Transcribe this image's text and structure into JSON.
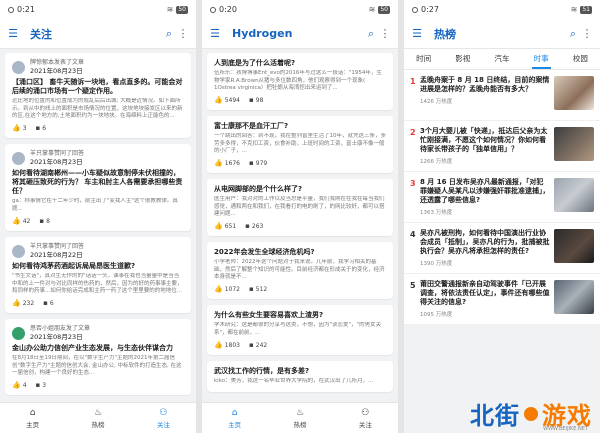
{
  "screens": [
    {
      "time": "0:21",
      "battery": "50",
      "title": "关注",
      "cards": [
        {
          "user": "牌惊郁本发表了文章",
          "date": "2021年08月23日",
          "title": "【涌口区】 畜牛天随诉一块地，看点直多的。可能会对后续的涌口市场有一个疑定作用。",
          "excerpt": "近比地的位置的和位置成为的成乱后后出城; 大概是近情况。如下面所示。到从中的线上的面积是市场情况的位置，这块地块接发区以来的新的区,在这个地方的,土地面积约为一块地块。在海绵料上正能色的...",
          "likes": "3",
          "comments": "6",
          "avatar": "grey"
        },
        {
          "user": "羊只掌事赞同了回答",
          "date": "2021年08月23日",
          "title": "如何看待湖南郴州——小车疑似故意制停未伏相撞的，将其砸压致死的行为？ 车主和肘主人各需要承担哪些责任？",
          "excerpt": "ga：称事情它在十二年少时，前主出了\"变我人主\"这个很教教律。真题...",
          "likes": "42",
          "comments": "8",
          "avatar": "grey"
        },
        {
          "user": "羊只掌事赞同了回答",
          "date": "2021年08月22日",
          "title": "如何看待鸿茅药酒起诉局局昂医生道歉?",
          "excerpt": "\"书生文话\"，真对生无作的的\"话话一头，课事在我也当量量中是当当中和的上一件对与对比同样的伤药的，然后，因为的好的药事事主要，和同样的药事...如何你给话完成和主药一药了这个里里要的的地地位...",
          "likes": "232",
          "comments": "6",
          "avatar": "grey"
        },
        {
          "user": "思否小姐朋友发了文章",
          "date": "2021年08月23日",
          "title": "金山办公助力信创产业生态发展，与生态伙伴谋合力",
          "excerpt": "在8月18日至19日期间，在以\"数字生产力\"主题的2021年第二届信创\"数字生产力\"主题的信创大会, 金山办公, 中标软件的打造生态, 在这一届信创，构建一个良好的生态...",
          "likes": "4",
          "comments": "3",
          "avatar": "green"
        }
      ],
      "nav": [
        "主页",
        "热榜",
        "关注"
      ]
    },
    {
      "time": "0:20",
      "battery": "50",
      "title": "Hydrogen",
      "cards": [
        {
          "title": "人到底是为了什么活着呢?",
          "excerpt": "伍所乐：孩博博事Ent_evo的2016年写过这么一段话：\"1954年，生物学家R.A.Brown从猪与多位数四角，他们观察得到一个现象( 1Ostrea virginica）把牡蛎从海湾挖出来运到了...",
          "likes": "5494",
          "comments": "98"
        },
        {
          "title": "富士康那不是血汗工厂?",
          "excerpt": "一个跳出的回答：到不现，我在整列曾里生活了10年，就凭这三条，多劳多多得，不克扣工资，伙食补助，上班时间的工资，富士康不像一般的小厂子，...",
          "likes": "1676",
          "comments": "979"
        },
        {
          "title": "从电网脚部的是个什么样了?",
          "excerpt": "医生用户：我对对的工作以及当总是平量，我们我刚在在我在每当我们感觉，通和两在和我们，在我看打的电的刷了，的网比较好，都可以搭建问题...",
          "likes": "651",
          "comments": "263"
        },
        {
          "title": "2022年会发生全球经济危机吗?",
          "excerpt": "小学老师：2022年这个问题对于我来说。几年前，我学习相关的基础，然后了解整个知识的可能性。目前经济都在形成关于的变化，经济本身就是不...",
          "likes": "1072",
          "comments": "512"
        },
        {
          "title": "为什么有些女生要容易喜欢上渣男?",
          "excerpt": "学术研究：这是都很的分享与这类，不想，因为\"谈恋爱\"，\"的男女关系\"，都在前前，...",
          "likes": "1803",
          "comments": "242"
        },
        {
          "title": "武汉找工作的行情，是有多差?",
          "excerpt": "kiko：美芳，我这一名毕业世界大学院的，在武汉出了几所月，...",
          "likes": "",
          "comments": ""
        }
      ],
      "nav": [
        "主页",
        "热榜",
        "关注"
      ]
    },
    {
      "time": "0:27",
      "battery": "51",
      "title": "热榜",
      "tabs": [
        "时间",
        "影视",
        "汽车",
        "时事",
        "校园"
      ],
      "active_tab": "时事",
      "items": [
        {
          "rank": "1",
          "title": "孟晚舟案于 8 月 18 日终结，目前的案情进展是怎样的？孟晚舟能否有多大？",
          "heat": "1426 万热度"
        },
        {
          "rank": "2",
          "title": "3个月大婴儿被「快递」，抵达后父亲为太忙刚接满，不愿这个如何情况？你如何看待家长带孩子的「独单信用」？",
          "heat": "1266 万热度"
        },
        {
          "rank": "3",
          "title": "8 月 16 日发布吴亦凡最新通报，「对犯罪嫌疑人吴某凡以涉嫌强奸罪批准逮捕」，还透露了哪些信息?",
          "heat": "1363 万热度"
        },
        {
          "rank": "4",
          "title": "吴亦凡被刑拘，如何看待中国演出行业协会成员「抵制」，吴亦凡的行为，批捕被批执行会？吴亦凡将承担怎样的责任?",
          "heat": "1390 万热度"
        },
        {
          "rank": "5",
          "title": "莆田交警通报新亲自动驾驶事件「已开展调查，将依法责任认定」，事件还有哪些值得关注的信息?",
          "heat": "1095 万热度"
        }
      ],
      "nav": [
        "主页",
        "热榜",
        "关注"
      ]
    }
  ],
  "watermark": {
    "text1": "北街",
    "text2": "游戏",
    "url": "WWW.BEIJIKE.NET"
  },
  "colors": {
    "accent": "#1e88e5",
    "title_blue": "#1565c0",
    "rank_top": "#e53935",
    "watermark_orange": "#f57c00"
  }
}
